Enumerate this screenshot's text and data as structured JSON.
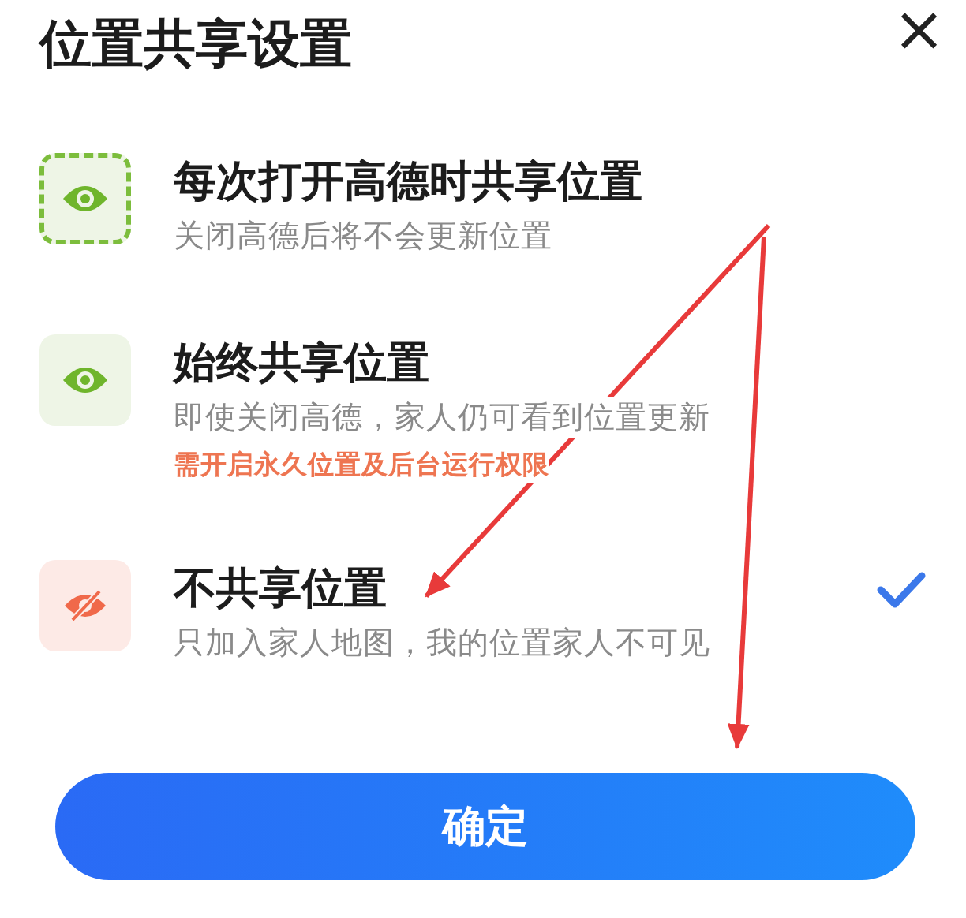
{
  "title": "位置共享设置",
  "close": "×",
  "options": [
    {
      "kind": "eye",
      "focused": true,
      "selected": false,
      "title": "每次打开高德时共享位置",
      "subtitle": "关闭高德后将不会更新位置"
    },
    {
      "kind": "eye",
      "focused": false,
      "selected": false,
      "title": "始终共享位置",
      "subtitle": "即使关闭高德，家人仍可看到位置更新",
      "warning": "需开启永久位置及后台运行权限"
    },
    {
      "kind": "eye_off",
      "focused": false,
      "selected": true,
      "title": "不共享位置",
      "subtitle": "只加入家人地图，我的位置家人不可见"
    }
  ],
  "confirm": "确定"
}
